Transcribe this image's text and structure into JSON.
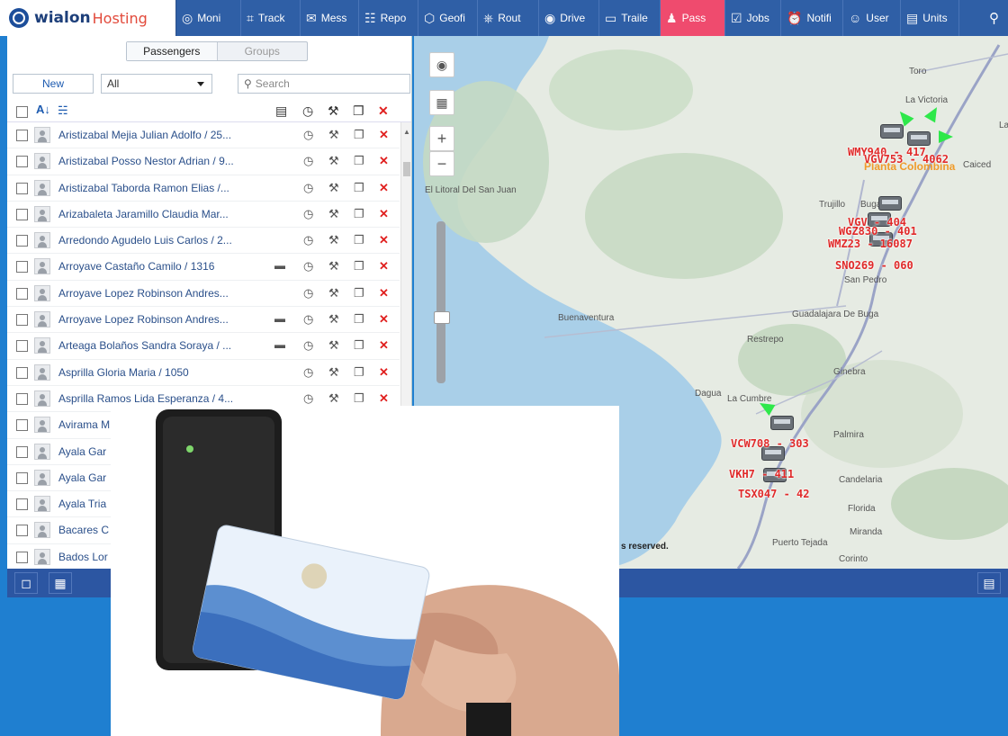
{
  "brand": {
    "name_part1": "wialon",
    "name_part2": "Hosting"
  },
  "nav": {
    "tabs": [
      {
        "label": "Moni",
        "icon": "monitoring-icon"
      },
      {
        "label": "Track",
        "icon": "tracks-icon"
      },
      {
        "label": "Mess",
        "icon": "messages-icon"
      },
      {
        "label": "Repo",
        "icon": "reports-icon"
      },
      {
        "label": "Geofi",
        "icon": "geofences-icon"
      },
      {
        "label": "Rout",
        "icon": "routes-icon"
      },
      {
        "label": "Drive",
        "icon": "drivers-icon"
      },
      {
        "label": "Traile",
        "icon": "trailers-icon"
      },
      {
        "label": "Pass",
        "icon": "passengers-icon",
        "active": true
      },
      {
        "label": "Jobs",
        "icon": "jobs-icon"
      },
      {
        "label": "Notifi",
        "icon": "notifications-icon"
      },
      {
        "label": "User",
        "icon": "users-icon"
      },
      {
        "label": "Units",
        "icon": "units-icon"
      }
    ]
  },
  "panel": {
    "segment": {
      "passengers": "Passengers",
      "groups": "Groups"
    },
    "new_label": "New",
    "filter_value": "All",
    "search_placeholder": "Search"
  },
  "passengers": [
    {
      "name": "Aristizabal Mejia Julian Adolfo / 25...",
      "bus": false
    },
    {
      "name": "Aristizabal Posso Nestor Adrian / 9...",
      "bus": false
    },
    {
      "name": "Aristizabal Taborda Ramon Elias /...",
      "bus": false
    },
    {
      "name": "Arizabaleta Jaramillo Claudia Mar...",
      "bus": false
    },
    {
      "name": "Arredondo Agudelo Luis Carlos / 2...",
      "bus": false
    },
    {
      "name": "Arroyave Castaño Camilo / 1316",
      "bus": true
    },
    {
      "name": "Arroyave Lopez Robinson Andres...",
      "bus": false
    },
    {
      "name": "Arroyave Lopez Robinson Andres...",
      "bus": true
    },
    {
      "name": "Arteaga Bolaños Sandra Soraya / ...",
      "bus": true
    },
    {
      "name": "Asprilla Gloria Maria / 1050",
      "bus": false
    },
    {
      "name": "Asprilla Ramos Lida Esperanza / 4...",
      "bus": false
    },
    {
      "name": "Avirama M",
      "bus": false
    },
    {
      "name": "Ayala Gar",
      "bus": false
    },
    {
      "name": "Ayala Gar",
      "bus": false
    },
    {
      "name": "Ayala Tria",
      "bus": false
    },
    {
      "name": "Bacares C",
      "bus": false
    },
    {
      "name": "Bados Lor",
      "bus": false
    }
  ],
  "map": {
    "towns": [
      "Toro",
      "La Victoria",
      "La Te",
      "Planta Colombina",
      "Caiced",
      "Trujillo",
      "Buga",
      "San Pedro",
      "El Litoral Del San Juan",
      "Buenaventura",
      "Guadalajara De Buga",
      "Restrepo",
      "Ginebra",
      "Dagua",
      "La Cumbre",
      "Palmira",
      "Candelaria",
      "Florida",
      "Miranda",
      "Puerto Tejada",
      "Corinto"
    ],
    "vehicles": [
      "WMY940 - 417",
      "VGV753 - 4062",
      "VGV - 404",
      "WGZ830 - 401",
      "WMZ23 - 16087",
      "SNO269 - 060",
      "VCW708 - 303",
      "VKH7 - 411",
      "TSX047 - 42"
    ],
    "copyright": "s reserved."
  },
  "photo": {
    "subject": "rfid-card-reader-photo"
  }
}
